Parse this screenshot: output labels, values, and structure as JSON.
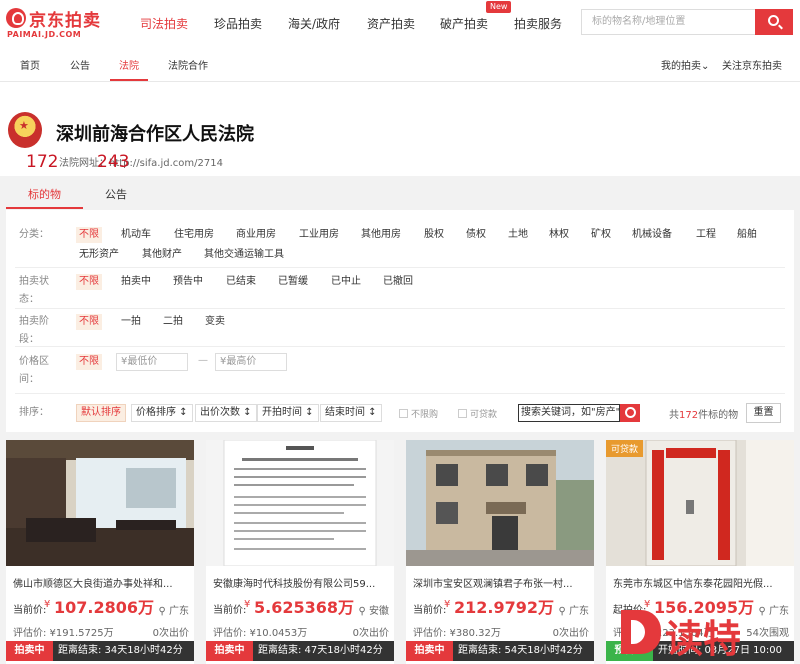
{
  "brand": {
    "name": "京东拍卖",
    "sub": "PAIMAI.JD.COM"
  },
  "nav": {
    "items": [
      "司法拍卖",
      "珍品拍卖",
      "海关/政府",
      "资产拍卖",
      "破产拍卖",
      "拍卖服务"
    ],
    "new_badge": "New"
  },
  "search": {
    "placeholder": "标的物名称/地理位置"
  },
  "subnav": {
    "items": [
      "首页",
      "公告",
      "法院",
      "法院合作"
    ],
    "right": [
      "我的拍卖",
      "关注京东拍卖"
    ]
  },
  "court": {
    "name": "深圳前海合作区人民法院",
    "stat1": "172",
    "stat2": "243",
    "url": "法院网址：http://sifa.jd.com/2714"
  },
  "tabs": [
    "标的物",
    "公告"
  ],
  "filters": {
    "category_label": "分类：",
    "category_row1": [
      "不限",
      "机动车",
      "住宅用房",
      "商业用房",
      "工业用房",
      "其他用房",
      "股权",
      "债权",
      "土地",
      "林权",
      "矿权",
      "机械设备",
      "工程",
      "船舶"
    ],
    "category_row2": [
      "无形资产",
      "其他财产",
      "其他交通运输工具"
    ],
    "status_label": "拍卖状态：",
    "status": [
      "不限",
      "拍卖中",
      "预告中",
      "已结束",
      "已暂缓",
      "已中止",
      "已撤回"
    ],
    "stage_label": "拍卖阶段：",
    "stage": [
      "不限",
      "一拍",
      "二拍",
      "变卖"
    ],
    "price_label": "价格区间：",
    "price_any": "不限",
    "price_min": "¥最低价",
    "price_dash": "—",
    "price_max": "¥最高价"
  },
  "sort": {
    "label": "排序：",
    "buttons": [
      "默认排序",
      "价格排序 ↕",
      "出价次数 ↕",
      "开拍时间 ↕",
      "结束时间 ↕"
    ],
    "checks": [
      "不限购",
      "可贷款"
    ],
    "keyword_placeholder": "搜索关键词，如\"房产\"",
    "total_pre": "共",
    "total_num": "172",
    "total_post": "件标的物",
    "reset": "重置"
  },
  "cards": [
    {
      "title": "佛山市顺德区大良街道办事处祥和...",
      "price_label": "当前价:",
      "price": "107.2806万",
      "loc": "广东",
      "est": "评估价: ¥191.5725万",
      "bids": "0次出价",
      "status": "拍卖中",
      "time": "距离结束: 34天18小时42分",
      "tag": ""
    },
    {
      "title": "安徽康海时代科技股份有限公司59...",
      "price_label": "当前价:",
      "price": "5.625368万",
      "loc": "安徽",
      "est": "评估价: ¥10.0453万",
      "bids": "0次出价",
      "status": "拍卖中",
      "time": "距离结束: 47天18小时42分",
      "tag": ""
    },
    {
      "title": "深圳市宝安区观澜镇君子布张一村...",
      "price_label": "当前价:",
      "price": "212.9792万",
      "loc": "广东",
      "est": "评估价: ¥380.32万",
      "bids": "0次出价",
      "status": "拍卖中",
      "time": "距离结束: 54天18小时42分",
      "tag": ""
    },
    {
      "title": "东莞市东城区中信东泰花园阳光假...",
      "price_label": "起拍价:",
      "price": "156.2095万",
      "loc": "广东",
      "est": "评估价: ¥223.1564万",
      "bids": "54次围观",
      "status": "预告中",
      "time": "开始时间: 03月27日 10:00",
      "tag": "可贷款"
    }
  ],
  "watermark": "读特"
}
